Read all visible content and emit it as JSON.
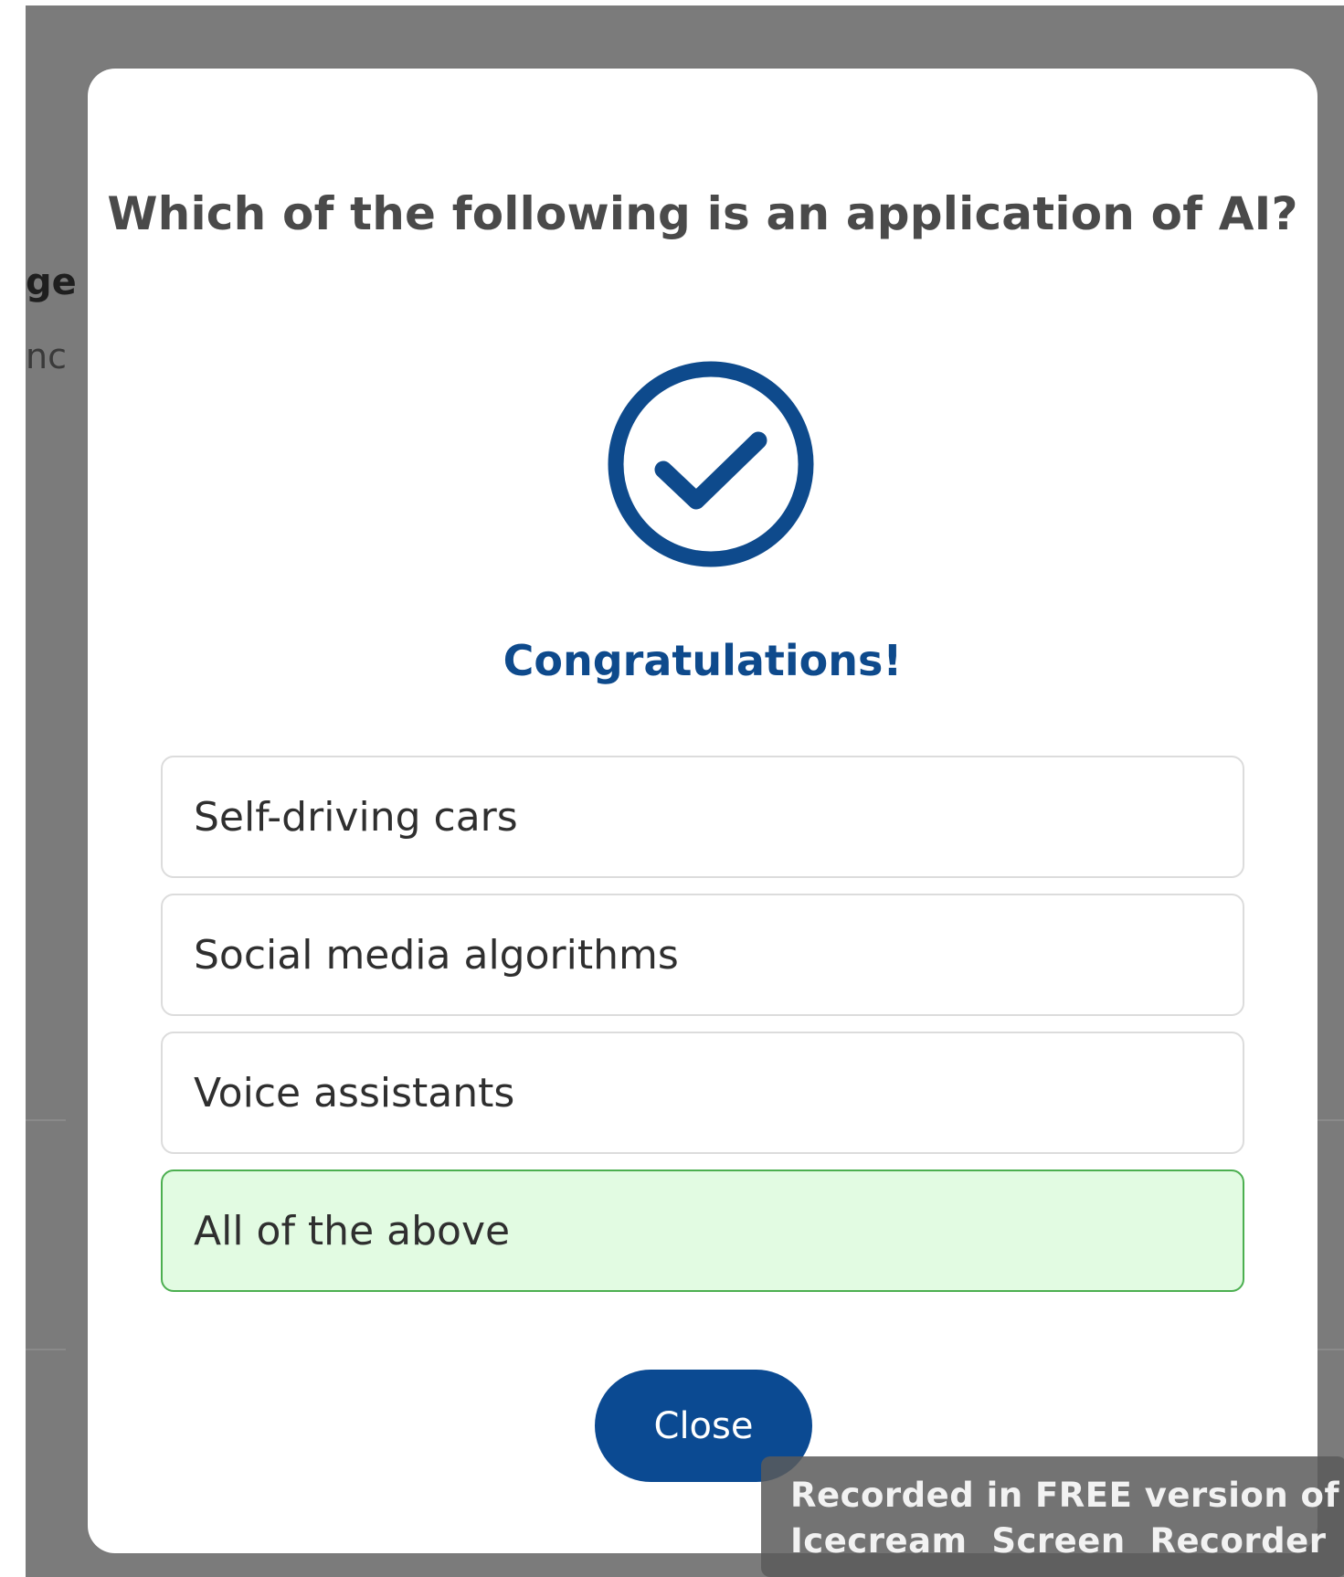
{
  "background": {
    "partial_heading": "ge",
    "partial_text": "nc"
  },
  "modal": {
    "question": "Which of the following is an application of AI?",
    "result_icon": "check-circle-icon",
    "result_message": "Congratulations!",
    "options": [
      {
        "label": "Self-driving cars",
        "state": "default"
      },
      {
        "label": "Social media algorithms",
        "state": "default"
      },
      {
        "label": "Voice assistants",
        "state": "default"
      },
      {
        "label": "All of the above",
        "state": "correct"
      }
    ],
    "close_label": "Close"
  },
  "watermark": {
    "line1": "Recorded in FREE version of",
    "line2": "Icecream  Screen  Recorder"
  },
  "colors": {
    "accent": "#0b4a92",
    "correct_fill": "#e2fbe2",
    "correct_border": "#4caf50",
    "overlay": "#7b7b7b"
  }
}
